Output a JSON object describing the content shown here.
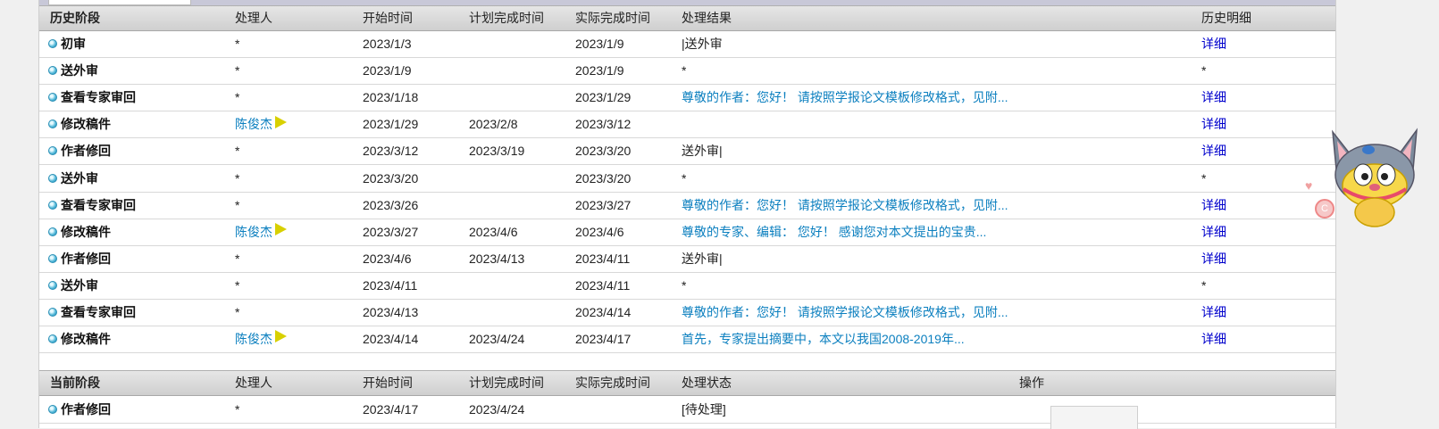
{
  "history": {
    "headers": {
      "stage": "历史阶段",
      "handler": "处理人",
      "start": "开始时间",
      "planned": "计划完成时间",
      "actual": "实际完成时间",
      "result": "处理结果",
      "detail": "历史明细"
    },
    "rows": [
      {
        "stage": "初审",
        "handler": "*",
        "start": "2023/1/3",
        "planned": "",
        "actual": "2023/1/9",
        "result": "|送外审",
        "detail": "详细"
      },
      {
        "stage": "送外审",
        "handler": "*",
        "start": "2023/1/9",
        "planned": "",
        "actual": "2023/1/9",
        "result": "*",
        "detail": "*"
      },
      {
        "stage": "查看专家审回",
        "handler": "*",
        "start": "2023/1/18",
        "planned": "",
        "actual": "2023/1/29",
        "result": "尊敬的作者：您好！ 请按照学报论文模板修改格式，见附...",
        "detail": "详细"
      },
      {
        "stage": "修改稿件",
        "handler": "陈俊杰",
        "start": "2023/1/29",
        "planned": "2023/2/8",
        "actual": "2023/3/12",
        "result": "",
        "detail": "详细"
      },
      {
        "stage": "作者修回",
        "handler": "*",
        "start": "2023/3/12",
        "planned": "2023/3/19",
        "actual": "2023/3/20",
        "result": "送外审|",
        "detail": "详细"
      },
      {
        "stage": "送外审",
        "handler": "*",
        "start": "2023/3/20",
        "planned": "",
        "actual": "2023/3/20",
        "result": "*",
        "detail": "*"
      },
      {
        "stage": "查看专家审回",
        "handler": "*",
        "start": "2023/3/26",
        "planned": "",
        "actual": "2023/3/27",
        "result": "尊敬的作者：您好！ 请按照学报论文模板修改格式，见附...",
        "detail": "详细"
      },
      {
        "stage": "修改稿件",
        "handler": "陈俊杰",
        "start": "2023/3/27",
        "planned": "2023/4/6",
        "actual": "2023/4/6",
        "result": "尊敬的专家、编辑： 您好！ 感谢您对本文提出的宝贵...",
        "detail": "详细"
      },
      {
        "stage": "作者修回",
        "handler": "*",
        "start": "2023/4/6",
        "planned": "2023/4/13",
        "actual": "2023/4/11",
        "result": "送外审|",
        "detail": "详细"
      },
      {
        "stage": "送外审",
        "handler": "*",
        "start": "2023/4/11",
        "planned": "",
        "actual": "2023/4/11",
        "result": "*",
        "detail": "*"
      },
      {
        "stage": "查看专家审回",
        "handler": "*",
        "start": "2023/4/13",
        "planned": "",
        "actual": "2023/4/14",
        "result": "尊敬的作者：您好！ 请按照学报论文模板修改格式，见附...",
        "detail": "详细"
      },
      {
        "stage": "修改稿件",
        "handler": "陈俊杰",
        "start": "2023/4/14",
        "planned": "2023/4/24",
        "actual": "2023/4/17",
        "result": "首先，专家提出摘要中，本文以我国2008-2019年...",
        "detail": "详细"
      }
    ]
  },
  "current": {
    "headers": {
      "stage": "当前阶段",
      "handler": "处理人",
      "start": "开始时间",
      "planned": "计划完成时间",
      "actual": "实际完成时间",
      "status": "处理状态",
      "action": "操作"
    },
    "rows": [
      {
        "stage": "作者修回",
        "handler": "*",
        "start": "2023/4/17",
        "planned": "2023/4/24",
        "actual": "",
        "status": "[待处理]"
      }
    ]
  },
  "colors": {
    "link": "#0b7fbf",
    "detail_link": "#0000cc",
    "header_bg": "#d8d8d8"
  },
  "icons": {
    "row_bullet": "blue-dot-icon",
    "handler_flag": "yellow-flag-icon",
    "mascot": "cartoon-cat-mascot"
  }
}
